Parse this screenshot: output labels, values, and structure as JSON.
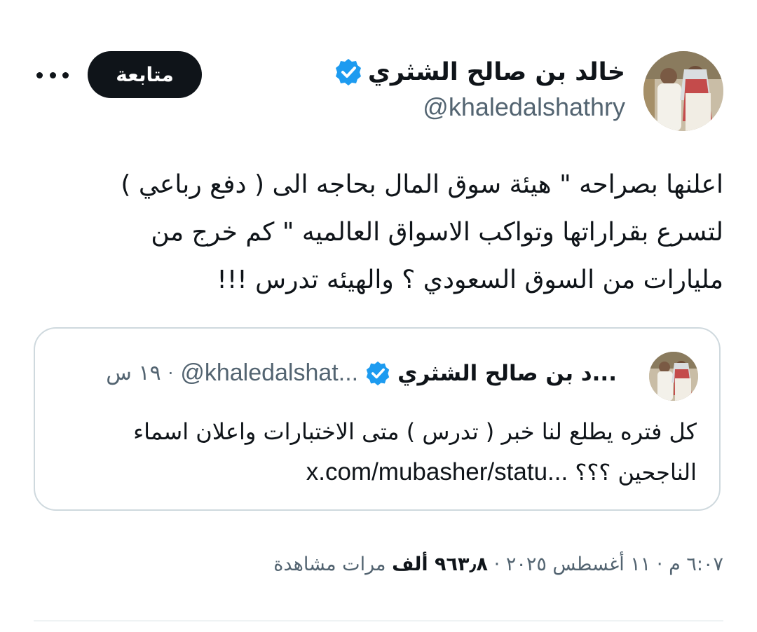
{
  "author": {
    "display_name": "خالد بن صالح الشثري",
    "handle": "@khaledalshathry",
    "verified": true,
    "avatar_icon": "profile-photo-two-men"
  },
  "actions": {
    "follow_label": "متابعة",
    "more_icon": "more-horizontal-icon"
  },
  "tweet": {
    "line1": "اعلنها بصراحه \" هيئة سوق المال بحاجه الى ( دفع رباعي )",
    "line2": "لتسرع بقراراتها وتواكب الاسواق العالميه \" كم خرج من",
    "line3": "مليارات من السوق السعودي ؟ والهيئه تدرس !!!"
  },
  "quote": {
    "display_name": "...د بن صالح الشثري",
    "handle": "@khaledalshat...",
    "separator": "·",
    "time": "١٩ س",
    "text_line1": "كل فتره يطلع لنا خبر ( تدرس ) متى الاختبارات واعلان اسماء",
    "text_line2_prefix": "الناجحين ؟؟؟",
    "link": "x.com/mubasher/statu..."
  },
  "meta": {
    "time": "٦:٠٧ م",
    "separator": "·",
    "date": "١١ أغسطس ٢٠٢٥",
    "views_count": "٩٦٣٫٨ ألف",
    "views_label": "مرات مشاهدة"
  },
  "colors": {
    "text": "#0f1419",
    "secondary": "#536471",
    "verified_blue": "#1d9bf0",
    "border": "#cfd9de"
  }
}
